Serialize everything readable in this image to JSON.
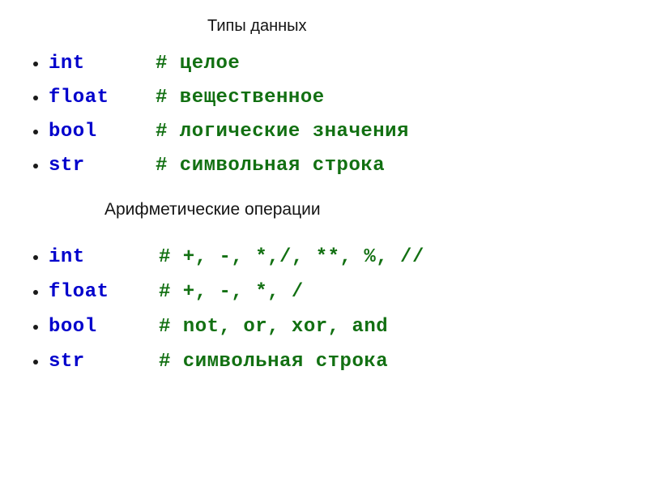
{
  "slide": {
    "background_color": "#ffffff",
    "type_color": "#0000cc",
    "comment_color": "#127012",
    "heading_color": "#141414",
    "bullet_color": "#1a1a1a"
  },
  "sections": [
    {
      "heading": "Типы данных",
      "rows": [
        {
          "type": "int",
          "comment": "# целое"
        },
        {
          "type": "float",
          "comment": "# вещественное"
        },
        {
          "type": "bool",
          "comment": "# логические значения"
        },
        {
          "type": "str",
          "comment": "# символьная строка"
        }
      ]
    },
    {
      "heading": "Арифметические операции",
      "rows": [
        {
          "type": "int",
          "comment": "# +, -, *,/, **, %, //"
        },
        {
          "type": "float",
          "comment": "# +, -, *, /"
        },
        {
          "type": "bool",
          "comment": "# not, or, xor, and"
        },
        {
          "type": "str",
          "comment": "# символьная строка"
        }
      ]
    }
  ]
}
